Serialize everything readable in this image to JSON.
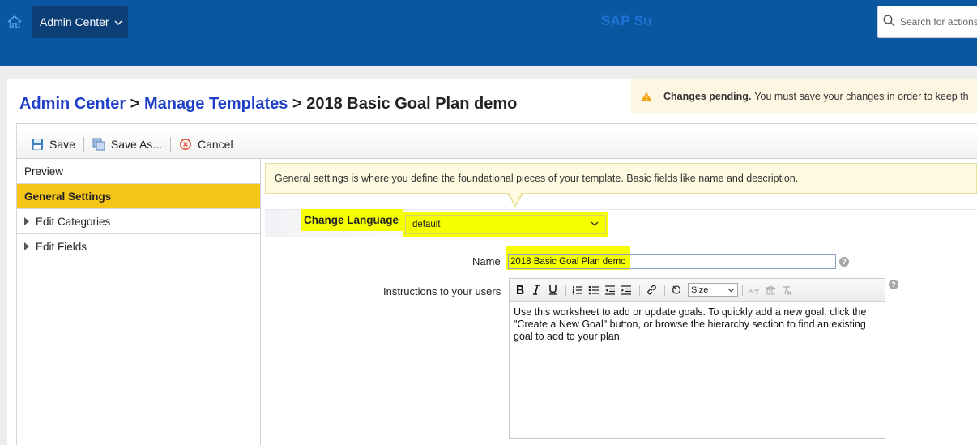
{
  "header": {
    "admin_label": "Admin Center",
    "brand": "SAP Su",
    "search_placeholder": "Search for actions"
  },
  "banner": {
    "bold": "Changes pending.",
    "text": "You must save your changes in order to keep th"
  },
  "breadcrumb": {
    "item1": "Admin Center",
    "sep": ">",
    "item2": "Manage Templates",
    "current": "2018 Basic Goal Plan demo"
  },
  "toolbar": {
    "save": "Save",
    "save_as": "Save As...",
    "cancel": "Cancel"
  },
  "nav": {
    "preview": "Preview",
    "general": "General Settings",
    "categories": "Edit Categories",
    "fields": "Edit Fields"
  },
  "info": {
    "text": "General settings is where you define the foundational pieces of your template. Basic fields like name and description."
  },
  "language": {
    "label": "Change Language",
    "value": "default"
  },
  "name_field": {
    "label": "Name",
    "value": "2018 Basic Goal Plan demo"
  },
  "instructions": {
    "label": "Instructions to your users",
    "size_label": "Size",
    "text": "Use this worksheet to add or update goals. To quickly add a new goal, click the \"Create a New Goal\" button, or browse the hierarchy section to find an existing goal to add to your plan."
  },
  "help_glyph": "?",
  "colors": {
    "header_bg": "#0a56a0",
    "highlight": "#f6ff00",
    "active_nav": "#f5c518",
    "link": "#1e3fc8"
  }
}
